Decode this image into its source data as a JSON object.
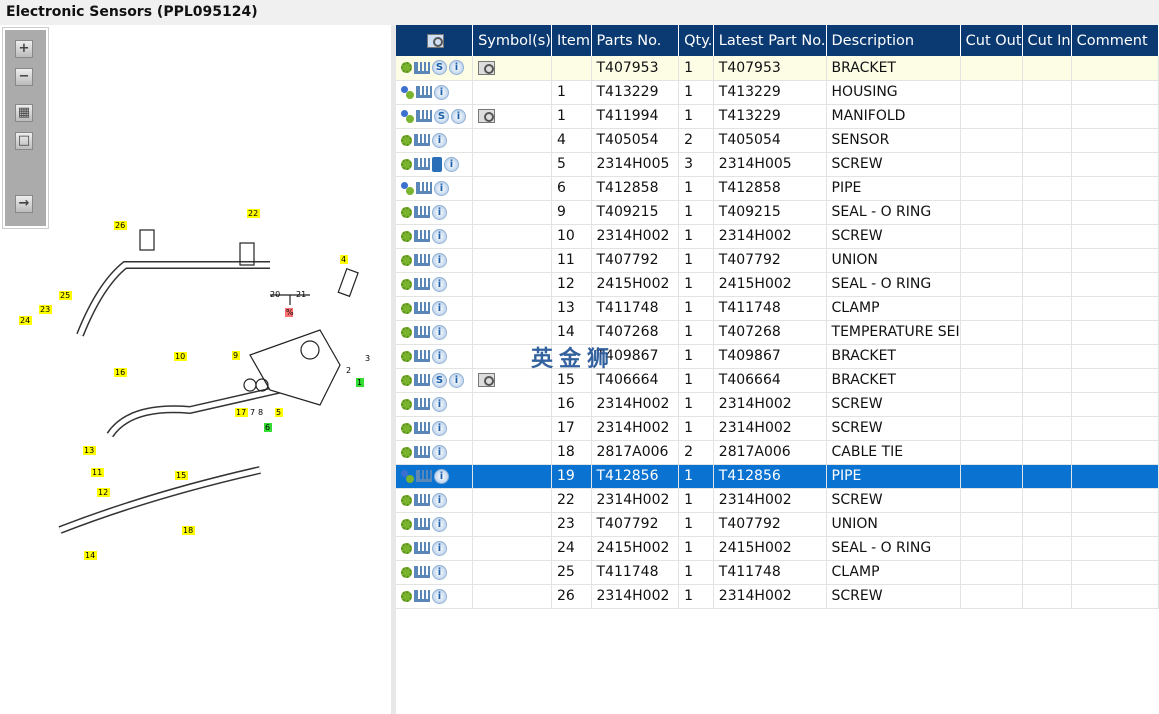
{
  "window": {
    "title": "Electronic Sensors (PPL095124)"
  },
  "toolbar": {
    "zoom_in": "zoom-in",
    "zoom_out": "zoom-out",
    "fit": "fit-all",
    "actual": "actual-size",
    "export": "export"
  },
  "watermark": "英金狮",
  "columns": [
    "",
    "Symbol(s)",
    "Item",
    "Parts No.",
    "Qty.",
    "Latest Part No.",
    "Description",
    "Cut Out",
    "Cut In",
    "Comment"
  ],
  "rows": [
    {
      "icons": [
        "gear",
        "cart",
        "s",
        "info"
      ],
      "symbol": true,
      "item": "",
      "part": "T407953",
      "qty": "1",
      "latest": "T407953",
      "desc": "BRACKET",
      "state": "highlight"
    },
    {
      "icons": [
        "gears",
        "cart",
        "info"
      ],
      "symbol": false,
      "item": "1",
      "part": "T413229",
      "qty": "1",
      "latest": "T413229",
      "desc": "HOUSING"
    },
    {
      "icons": [
        "gears",
        "cart",
        "s",
        "info"
      ],
      "symbol": true,
      "item": "1",
      "part": "T411994",
      "qty": "1",
      "latest": "T413229",
      "desc": "MANIFOLD"
    },
    {
      "icons": [
        "gear",
        "cart",
        "info"
      ],
      "symbol": false,
      "item": "4",
      "part": "T405054",
      "qty": "2",
      "latest": "T405054",
      "desc": "SENSOR"
    },
    {
      "icons": [
        "gear",
        "cart",
        "book",
        "info"
      ],
      "symbol": false,
      "item": "5",
      "part": "2314H005",
      "qty": "3",
      "latest": "2314H005",
      "desc": "SCREW"
    },
    {
      "icons": [
        "gears",
        "cart",
        "info"
      ],
      "symbol": false,
      "item": "6",
      "part": "T412858",
      "qty": "1",
      "latest": "T412858",
      "desc": "PIPE"
    },
    {
      "icons": [
        "gear",
        "cart",
        "info"
      ],
      "symbol": false,
      "item": "9",
      "part": "T409215",
      "qty": "1",
      "latest": "T409215",
      "desc": "SEAL - O RING"
    },
    {
      "icons": [
        "gear",
        "cart",
        "info"
      ],
      "symbol": false,
      "item": "10",
      "part": "2314H002",
      "qty": "1",
      "latest": "2314H002",
      "desc": "SCREW"
    },
    {
      "icons": [
        "gear",
        "cart",
        "info"
      ],
      "symbol": false,
      "item": "11",
      "part": "T407792",
      "qty": "1",
      "latest": "T407792",
      "desc": "UNION"
    },
    {
      "icons": [
        "gear",
        "cart",
        "info"
      ],
      "symbol": false,
      "item": "12",
      "part": "2415H002",
      "qty": "1",
      "latest": "2415H002",
      "desc": "SEAL - O RING"
    },
    {
      "icons": [
        "gear",
        "cart",
        "info"
      ],
      "symbol": false,
      "item": "13",
      "part": "T411748",
      "qty": "1",
      "latest": "T411748",
      "desc": "CLAMP"
    },
    {
      "icons": [
        "gear",
        "cart",
        "info"
      ],
      "symbol": false,
      "item": "14",
      "part": "T407268",
      "qty": "1",
      "latest": "T407268",
      "desc": "TEMPERATURE SEI"
    },
    {
      "icons": [
        "gear",
        "cart",
        "info"
      ],
      "symbol": false,
      "item": "",
      "part": "T409867",
      "qty": "1",
      "latest": "T409867",
      "desc": "BRACKET"
    },
    {
      "icons": [
        "gear",
        "cart",
        "s",
        "info"
      ],
      "symbol": true,
      "item": "15",
      "part": "T406664",
      "qty": "1",
      "latest": "T406664",
      "desc": "BRACKET"
    },
    {
      "icons": [
        "gear",
        "cart",
        "info"
      ],
      "symbol": false,
      "item": "16",
      "part": "2314H002",
      "qty": "1",
      "latest": "2314H002",
      "desc": "SCREW"
    },
    {
      "icons": [
        "gear",
        "cart",
        "info"
      ],
      "symbol": false,
      "item": "17",
      "part": "2314H002",
      "qty": "1",
      "latest": "2314H002",
      "desc": "SCREW"
    },
    {
      "icons": [
        "gear",
        "cart",
        "info"
      ],
      "symbol": false,
      "item": "18",
      "part": "2817A006",
      "qty": "2",
      "latest": "2817A006",
      "desc": "CABLE TIE"
    },
    {
      "icons": [
        "gears",
        "cart",
        "info"
      ],
      "symbol": false,
      "item": "19",
      "part": "T412856",
      "qty": "1",
      "latest": "T412856",
      "desc": "PIPE",
      "state": "selected"
    },
    {
      "icons": [
        "gear",
        "cart",
        "info"
      ],
      "symbol": false,
      "item": "22",
      "part": "2314H002",
      "qty": "1",
      "latest": "2314H002",
      "desc": "SCREW"
    },
    {
      "icons": [
        "gear",
        "cart",
        "info"
      ],
      "symbol": false,
      "item": "23",
      "part": "T407792",
      "qty": "1",
      "latest": "T407792",
      "desc": "UNION"
    },
    {
      "icons": [
        "gear",
        "cart",
        "info"
      ],
      "symbol": false,
      "item": "24",
      "part": "2415H002",
      "qty": "1",
      "latest": "2415H002",
      "desc": "SEAL - O RING"
    },
    {
      "icons": [
        "gear",
        "cart",
        "info"
      ],
      "symbol": false,
      "item": "25",
      "part": "T411748",
      "qty": "1",
      "latest": "T411748",
      "desc": "CLAMP"
    },
    {
      "icons": [
        "gear",
        "cart",
        "info"
      ],
      "symbol": false,
      "item": "26",
      "part": "2314H002",
      "qty": "1",
      "latest": "2314H002",
      "desc": "SCREW"
    }
  ],
  "diagram": {
    "callouts": [
      {
        "t": "26",
        "c": "#ffff00"
      },
      {
        "t": "22",
        "c": "#ffff00"
      },
      {
        "t": "4",
        "c": "#ffff00"
      },
      {
        "t": "25",
        "c": "#ffff00"
      },
      {
        "t": "23",
        "c": "#ffff00"
      },
      {
        "t": "24",
        "c": "#ffff00"
      },
      {
        "t": "20",
        "c": "none"
      },
      {
        "t": "21",
        "c": "none"
      },
      {
        "t": "%",
        "c": "#ff7070"
      },
      {
        "t": "10",
        "c": "#ffff00"
      },
      {
        "t": "9",
        "c": "#ffff00"
      },
      {
        "t": "3",
        "c": "none"
      },
      {
        "t": "2",
        "c": "none"
      },
      {
        "t": "1",
        "c": "#33dd33"
      },
      {
        "t": "16",
        "c": "#ffff00"
      },
      {
        "t": "7",
        "c": "none"
      },
      {
        "t": "8",
        "c": "none"
      },
      {
        "t": "17",
        "c": "#ffff00"
      },
      {
        "t": "5",
        "c": "#ffff00"
      },
      {
        "t": "6",
        "c": "#33dd33"
      },
      {
        "t": "13",
        "c": "#ffff00"
      },
      {
        "t": "11",
        "c": "#ffff00"
      },
      {
        "t": "15",
        "c": "#ffff00"
      },
      {
        "t": "12",
        "c": "#ffff00"
      },
      {
        "t": "14",
        "c": "#ffff00"
      },
      {
        "t": "18",
        "c": "#ffff00"
      }
    ]
  }
}
